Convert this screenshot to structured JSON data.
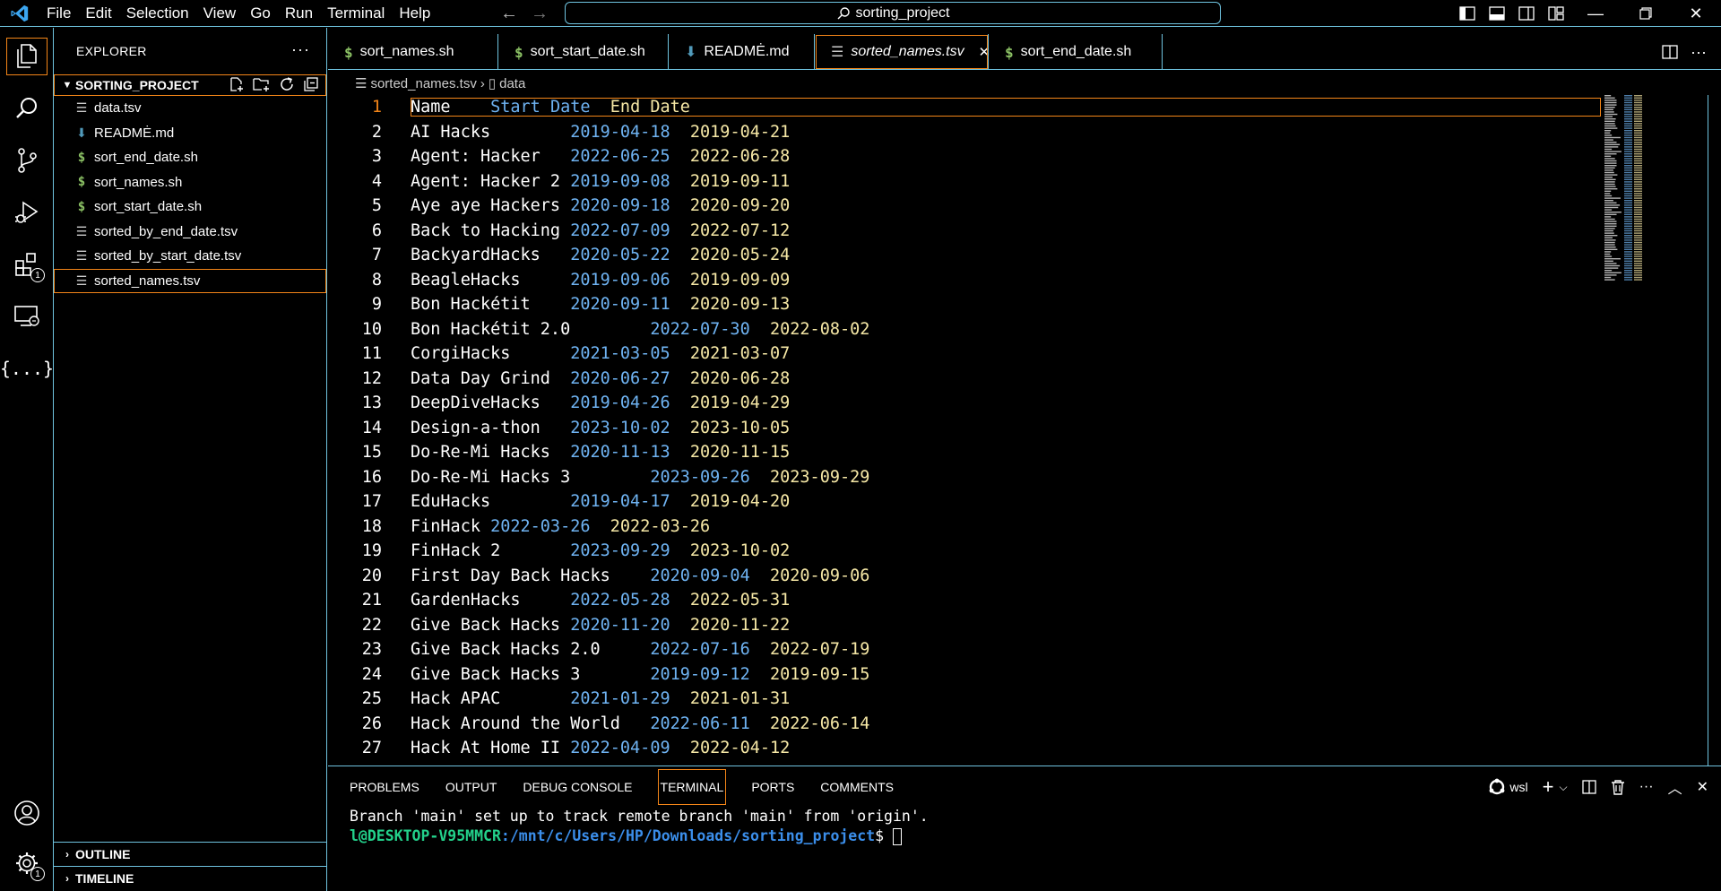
{
  "menu": [
    "File",
    "Edit",
    "Selection",
    "View",
    "Go",
    "Run",
    "Terminal",
    "Help"
  ],
  "search": {
    "text": "sorting_project"
  },
  "explorer": {
    "title": "EXPLORER",
    "project": "SORTING_PROJECT",
    "files": [
      {
        "name": "data.tsv",
        "type": "tsv"
      },
      {
        "name": "READMĖ.md",
        "type": "md"
      },
      {
        "name": "sort_end_date.sh",
        "type": "sh"
      },
      {
        "name": "sort_names.sh",
        "type": "sh"
      },
      {
        "name": "sort_start_date.sh",
        "type": "sh"
      },
      {
        "name": "sorted_by_end_date.tsv",
        "type": "tsv"
      },
      {
        "name": "sorted_by_start_date.tsv",
        "type": "tsv"
      },
      {
        "name": "sorted_names.tsv",
        "type": "tsv",
        "selected": true
      }
    ],
    "outline": "OUTLINE",
    "timeline": "TIMELINE"
  },
  "tabs": [
    {
      "label": "sort_names.sh",
      "icon": "sh"
    },
    {
      "label": "sort_start_date.sh",
      "icon": "sh"
    },
    {
      "label": "READMĖ.md",
      "icon": "md"
    },
    {
      "label": "sorted_names.tsv",
      "icon": "tsv",
      "active": true
    },
    {
      "label": "sort_end_date.sh",
      "icon": "sh"
    }
  ],
  "breadcrumb": {
    "file": "sorted_names.tsv",
    "symbol": "data"
  },
  "editor": {
    "header": {
      "name": "Name",
      "start": "Start Date",
      "end": "End Date"
    },
    "rows": [
      {
        "ln": "2",
        "name": "AI Hacks",
        "start": "2019-04-18",
        "end": "2019-04-21"
      },
      {
        "ln": "3",
        "name": "Agent: Hacker",
        "start": "2022-06-25",
        "end": "2022-06-28"
      },
      {
        "ln": "4",
        "name": "Agent: Hacker 2",
        "start": "2019-09-08",
        "end": "2019-09-11"
      },
      {
        "ln": "5",
        "name": "Aye aye Hackers",
        "start": "2020-09-18",
        "end": "2020-09-20"
      },
      {
        "ln": "6",
        "name": "Back to Hacking",
        "start": "2022-07-09",
        "end": "2022-07-12"
      },
      {
        "ln": "7",
        "name": "BackyardHacks",
        "start": "2020-05-22",
        "end": "2020-05-24"
      },
      {
        "ln": "8",
        "name": "BeagleHacks",
        "start": "2019-09-06",
        "end": "2019-09-09"
      },
      {
        "ln": "9",
        "name": "Bon Hackétit",
        "start": "2020-09-11",
        "end": "2020-09-13"
      },
      {
        "ln": "10",
        "name": "Bon Hackétit 2.0",
        "start": "2022-07-30",
        "end": "2022-08-02"
      },
      {
        "ln": "11",
        "name": "CorgiHacks",
        "start": "2021-03-05",
        "end": "2021-03-07"
      },
      {
        "ln": "12",
        "name": "Data Day Grind",
        "start": "2020-06-27",
        "end": "2020-06-28"
      },
      {
        "ln": "13",
        "name": "DeepDiveHacks",
        "start": "2019-04-26",
        "end": "2019-04-29"
      },
      {
        "ln": "14",
        "name": "Design-a-thon",
        "start": "2023-10-02",
        "end": "2023-10-05"
      },
      {
        "ln": "15",
        "name": "Do-Re-Mi Hacks",
        "start": "2020-11-13",
        "end": "2020-11-15"
      },
      {
        "ln": "16",
        "name": "Do-Re-Mi Hacks 3",
        "start": "2023-09-26",
        "end": "2023-09-29"
      },
      {
        "ln": "17",
        "name": "EduHacks",
        "start": "2019-04-17",
        "end": "2019-04-20"
      },
      {
        "ln": "18",
        "name": "FinHack",
        "start": "2022-03-26",
        "end": "2022-03-26"
      },
      {
        "ln": "19",
        "name": "FinHack 2",
        "start": "2023-09-29",
        "end": "2023-10-02"
      },
      {
        "ln": "20",
        "name": "First Day Back Hacks",
        "start": "2020-09-04",
        "end": "2020-09-06"
      },
      {
        "ln": "21",
        "name": "GardenHacks",
        "start": "2022-05-28",
        "end": "2022-05-31"
      },
      {
        "ln": "22",
        "name": "Give Back Hacks",
        "start": "2020-11-20",
        "end": "2020-11-22"
      },
      {
        "ln": "23",
        "name": "Give Back Hacks 2.0",
        "start": "2022-07-16",
        "end": "2022-07-19"
      },
      {
        "ln": "24",
        "name": "Give Back Hacks 3",
        "start": "2019-09-12",
        "end": "2019-09-15"
      },
      {
        "ln": "25",
        "name": "Hack APAC",
        "start": "2021-01-29",
        "end": "2021-01-31"
      },
      {
        "ln": "26",
        "name": "Hack Around the World",
        "start": "2022-06-11",
        "end": "2022-06-14"
      },
      {
        "ln": "27",
        "name": "Hack At Home II",
        "start": "2022-04-09",
        "end": "2022-04-12"
      }
    ]
  },
  "panel": {
    "tabs": [
      "PROBLEMS",
      "OUTPUT",
      "DEBUG CONSOLE",
      "TERMINAL",
      "PORTS",
      "COMMENTS"
    ],
    "active_tab": "TERMINAL",
    "shell": "wsl",
    "terminal_line1": "Branch 'main' set up to track remote branch 'main' from 'origin'.",
    "prompt_user": "l@DESKTOP-V95MMCR",
    "prompt_path": ":/mnt/c/Users/HP/Downloads/sorting_project",
    "prompt_symbol": "$ "
  },
  "badges": {
    "extensions": "1",
    "manage": "1"
  },
  "colors": {
    "contrast_border": "#6fc3df",
    "active_outline": "#f38518",
    "start_date": "#6fb3f2",
    "end_date": "#f6e8a6"
  }
}
